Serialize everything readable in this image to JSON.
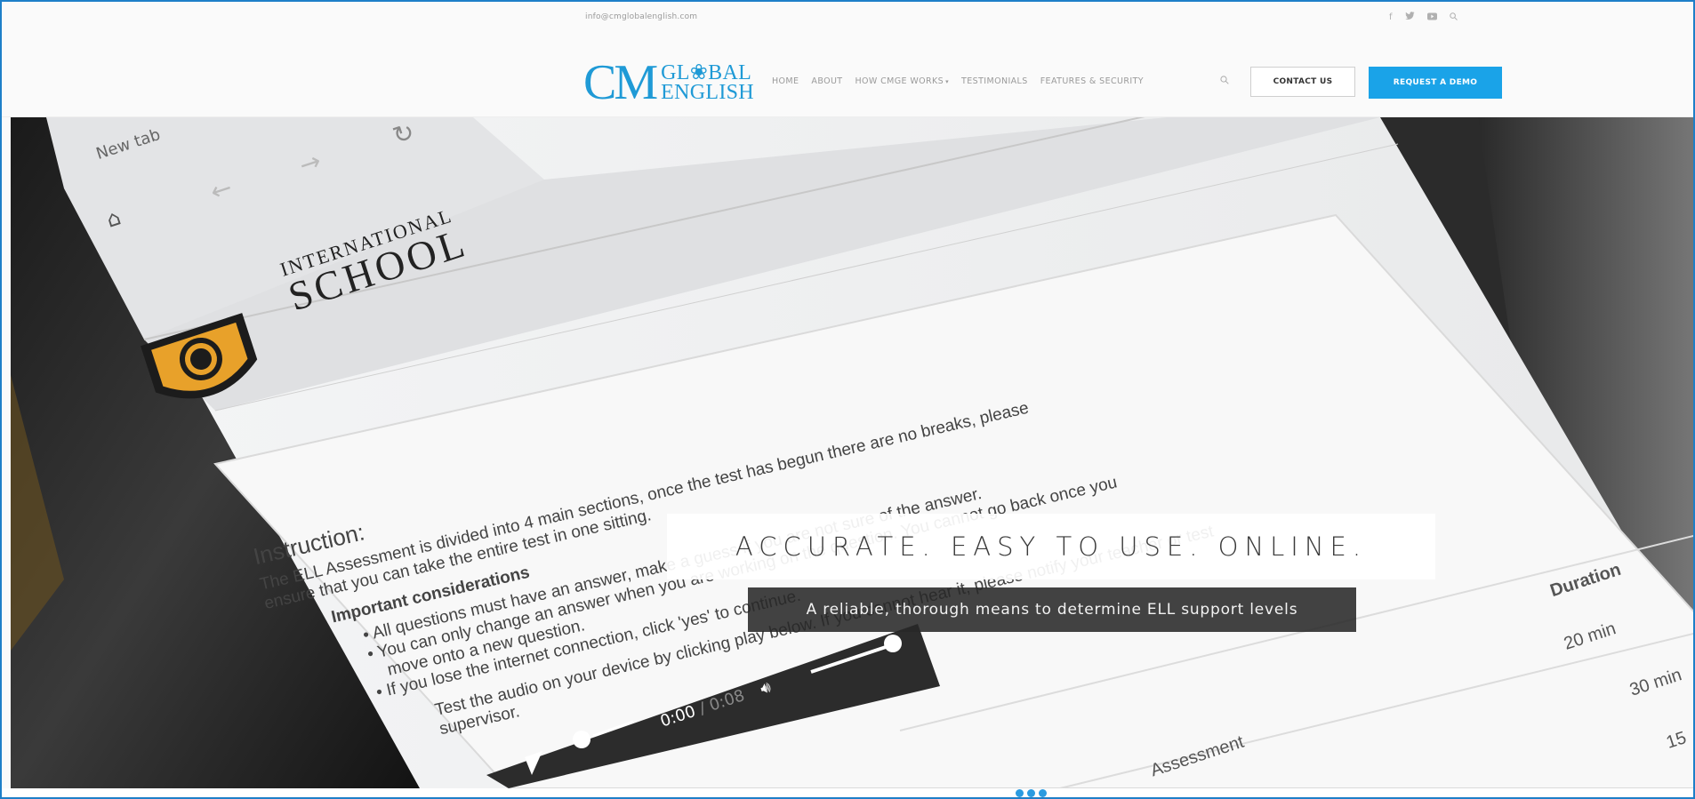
{
  "topbar": {
    "email": "info@cmglobalenglish.com",
    "social": [
      {
        "name": "facebook-icon",
        "glyph": "f"
      },
      {
        "name": "twitter-icon",
        "glyph": "⁕"
      },
      {
        "name": "youtube-icon",
        "glyph": "■"
      },
      {
        "name": "search-icon",
        "glyph": "⌕"
      }
    ]
  },
  "logo": {
    "mark": "CM",
    "line1": "GL❀BAL",
    "line2": "ENGLISH"
  },
  "nav": {
    "items": [
      "HOME",
      "ABOUT",
      "HOW CMGE WORKS",
      "TESTIMONIALS",
      "FEATURES & SECURITY"
    ],
    "search_glyph": "⌕",
    "contact_label": "CONTACT US",
    "demo_label": "REQUEST A DEMO"
  },
  "hero": {
    "title": "ACCURATE. EASY TO USE. ONLINE.",
    "subtitle": "A reliable, thorough means to determine ELL support levels",
    "image": {
      "tab_label": "New tab",
      "school_line1": "INTERNATIONAL",
      "school_line2": "SCHOOL",
      "instruction_heading": "Instruction:",
      "instruction_line1": "The ELL Assessment is divided into 4 main sections, once the test has begun there are no breaks, please",
      "instruction_line2": "ensure that you can take the entire test in one sitting.",
      "considerations_heading": "Important considerations",
      "bullet1": "All questions must have an answer, make a guess if you are not sure of the answer.",
      "bullet2a": "You can only change an answer when you are working on the question. You cannot go back once you",
      "bullet2b": "move onto a new question.",
      "bullet3": "If you lose the internet connection, click 'yes' to continue.",
      "audio_line1": "Test the audio on your device by clicking play below. If you cannot hear it, please notify your teacher or test",
      "audio_line2": "supervisor.",
      "player_time": "0:00",
      "player_total": "/ 0:08",
      "duration_header": "Duration",
      "duration1": "20 min",
      "duration2": "30 min",
      "duration3": "15",
      "assessment_label": "Assessment"
    }
  },
  "colors": {
    "brand_blue": "#1f9ad6",
    "demo_button": "#1aa3e8"
  }
}
